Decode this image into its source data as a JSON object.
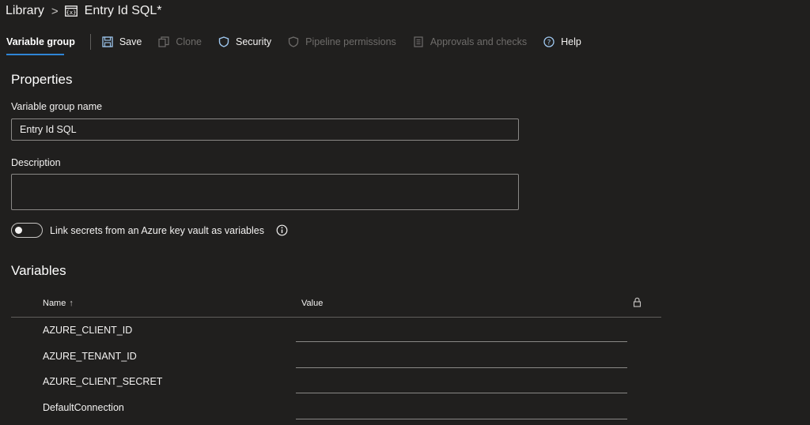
{
  "breadcrumb": {
    "root": "Library",
    "separator": ">",
    "current": "Entry Id SQL*"
  },
  "toolbar": {
    "active_tab": "Variable group",
    "save": "Save",
    "clone": "Clone",
    "security": "Security",
    "pipeline_permissions": "Pipeline permissions",
    "approvals": "Approvals and checks",
    "help": "Help"
  },
  "properties": {
    "heading": "Properties",
    "name_label": "Variable group name",
    "name_value": "Entry Id SQL",
    "description_label": "Description",
    "description_value": "",
    "keyvault_toggle_label": "Link secrets from an Azure key vault as variables",
    "keyvault_toggle_on": false
  },
  "variables": {
    "heading": "Variables",
    "columns": {
      "name": "Name",
      "sort_indicator": "↑",
      "value": "Value"
    },
    "rows": [
      {
        "name": "AZURE_CLIENT_ID",
        "value": ""
      },
      {
        "name": "AZURE_TENANT_ID",
        "value": ""
      },
      {
        "name": "AZURE_CLIENT_SECRET",
        "value": ""
      },
      {
        "name": "DefaultConnection",
        "value": ""
      }
    ]
  },
  "colors": {
    "background": "#201f1e",
    "accent": "#2f85d6",
    "text": "#f3f2f1",
    "disabled_text": "#6e6c6a"
  }
}
